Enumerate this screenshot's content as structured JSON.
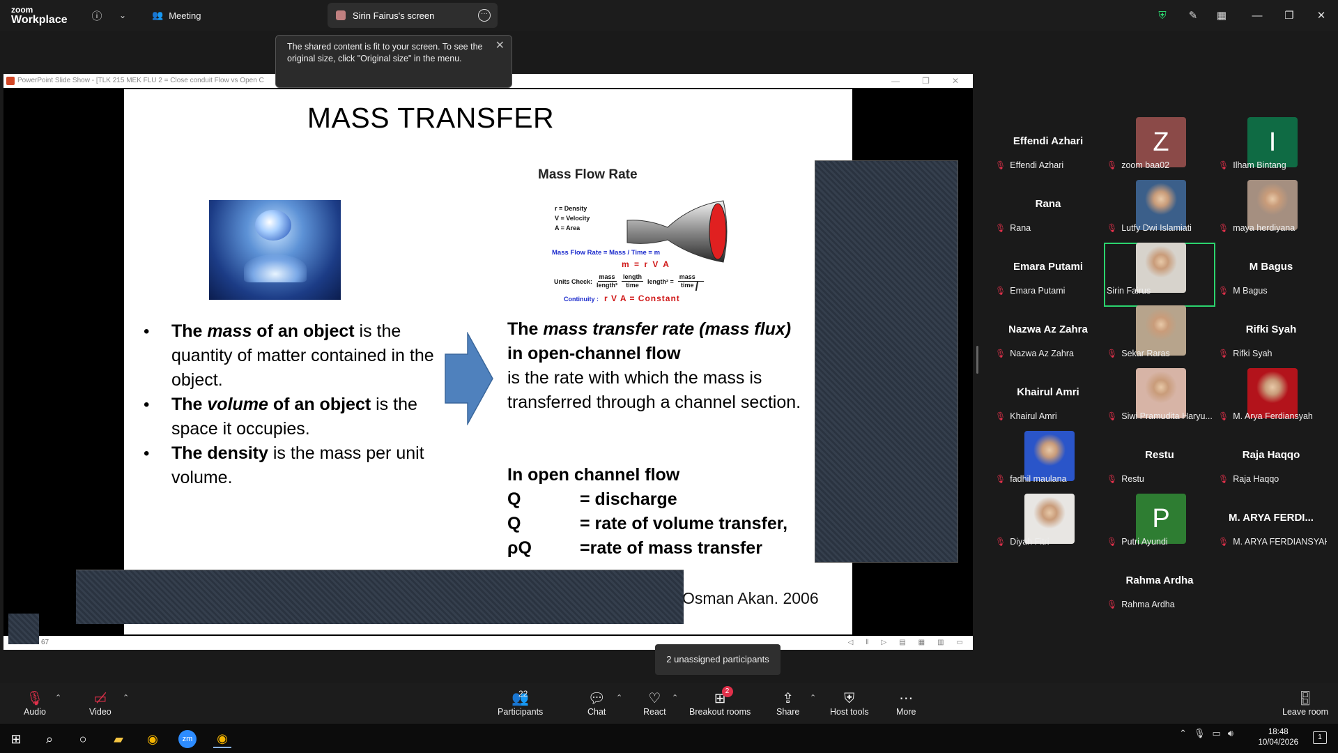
{
  "topbar": {
    "brand_line1": "zoom",
    "brand_line2": "Workplace",
    "meeting_label": "Meeting",
    "screen_tab_label": "Sirin Fairus's screen"
  },
  "tooltip": {
    "text": "The shared content is fit to your screen. To see the original size, click \"Original size\" in the menu."
  },
  "ppt": {
    "window_title": "PowerPoint Slide Show - [TLK 215 MEK FLU 2 = Close conduit Flow vs Open C",
    "status_number": "67"
  },
  "slide": {
    "title": "MASS TRANSFER",
    "mfr_title": "Mass Flow Rate",
    "legend": [
      "r = Density",
      "V = Velocity",
      "A = Area"
    ],
    "eq1": "Mass Flow Rate = Mass / Time = m",
    "eq2": "m = r V A",
    "units_label": "Units Check:",
    "units_frac1_num": "mass",
    "units_frac1_den": "length³",
    "units_frac2_num": "length",
    "units_frac2_den": "time",
    "units_mid": "length² =",
    "units_frac3_num": "mass",
    "units_frac3_den": "time",
    "continuity_label": "Continuity :",
    "continuity_eq": "r V A = Constant",
    "bullets": [
      {
        "b1": "The ",
        "i": "mass",
        "b2": " of an object",
        "rest": " is the quantity of matter contained in the object."
      },
      {
        "b1": "The ",
        "i": "volume",
        "b2": " of an object",
        "rest": " is the space it occupies."
      },
      {
        "b1": "The  density",
        "i": "",
        "b2": "",
        "rest": " is the mass per unit volume."
      }
    ],
    "right_bold_1": "The ",
    "right_bold_italic": "mass transfer rate (mass flux)",
    "right_bold_2": "in open-channel flow",
    "right_rest": "is the rate with which the mass is transferred through a channel section.",
    "defs_heading": "In open channel flow",
    "defs": [
      {
        "sym": "Q",
        "desc": "= discharge"
      },
      {
        "sym": "Q",
        "desc": "= rate of volume transfer,"
      },
      {
        "sym": "ρQ",
        "desc": "=rate of mass transfer"
      }
    ],
    "credit": "Osman Akan. 2006"
  },
  "unassigned_label": "2 unassigned participants",
  "participants": [
    {
      "big": "Effendi Azhari",
      "label": "Effendi Azhari",
      "kind": "name"
    },
    {
      "big": "Z",
      "label": "zoom baa02",
      "kind": "letter",
      "color": "#8b4a48"
    },
    {
      "big": "I",
      "label": "Ilham Bintang",
      "kind": "letter",
      "color": "#0f6b44"
    },
    {
      "big": "Rana",
      "label": "Rana",
      "kind": "name"
    },
    {
      "big": "",
      "label": "Lutfy Dwi Islamiati",
      "kind": "photo",
      "color": "#3b5f8a"
    },
    {
      "big": "",
      "label": "maya herdiyana",
      "kind": "photo",
      "color": "#a58f80"
    },
    {
      "big": "Emara Putami",
      "label": "Emara Putami",
      "kind": "name"
    },
    {
      "big": "",
      "label": "Sirin Fairus",
      "kind": "photo",
      "color": "#d7d3cc",
      "active": true
    },
    {
      "big": "M Bagus",
      "label": "M Bagus",
      "kind": "name"
    },
    {
      "big": "Nazwa Az Zahra",
      "label": "Nazwa Az Zahra",
      "kind": "name"
    },
    {
      "big": "",
      "label": "Sekar Raras",
      "kind": "photo",
      "color": "#b7a48c"
    },
    {
      "big": "Rifki Syah",
      "label": "Rifki Syah",
      "kind": "name"
    },
    {
      "big": "Khairul Amri",
      "label": "Khairul Amri",
      "kind": "name"
    },
    {
      "big": "",
      "label": "Siwi Pramudita Haryu...",
      "kind": "photo",
      "color": "#d7b4a6"
    },
    {
      "big": "",
      "label": "M. Arya Ferdiansyah",
      "kind": "photo",
      "color": "#b3131b"
    },
    {
      "big": "",
      "label": "fadhil maulana",
      "kind": "photo",
      "color": "#2a55c9"
    },
    {
      "big": "Restu",
      "label": "Restu",
      "kind": "name"
    },
    {
      "big": "Raja Haqqo",
      "label": "Raja Haqqo",
      "kind": "name"
    },
    {
      "big": "",
      "label": "Diyah Fitri",
      "kind": "photo",
      "color": "#e8e6e3"
    },
    {
      "big": "P",
      "label": "Putri Ayundi",
      "kind": "letter",
      "color": "#2e7d32"
    },
    {
      "big": "M. ARYA FERDI...",
      "label": "M. ARYA FERDIANSYAH",
      "kind": "name"
    },
    {
      "big": "",
      "label": "",
      "kind": "empty"
    },
    {
      "big": "Rahma Ardha",
      "label": "Rahma Ardha",
      "kind": "name"
    }
  ],
  "toolbar": {
    "audio": "Audio",
    "video": "Video",
    "participants": "Participants",
    "participants_count": "22",
    "chat": "Chat",
    "react": "React",
    "breakout": "Breakout rooms",
    "breakout_badge": "2",
    "share": "Share",
    "host_tools": "Host tools",
    "more": "More",
    "leave": "Leave room"
  },
  "taskbar": {
    "time": "18:48",
    "date": "10/04/2026"
  }
}
